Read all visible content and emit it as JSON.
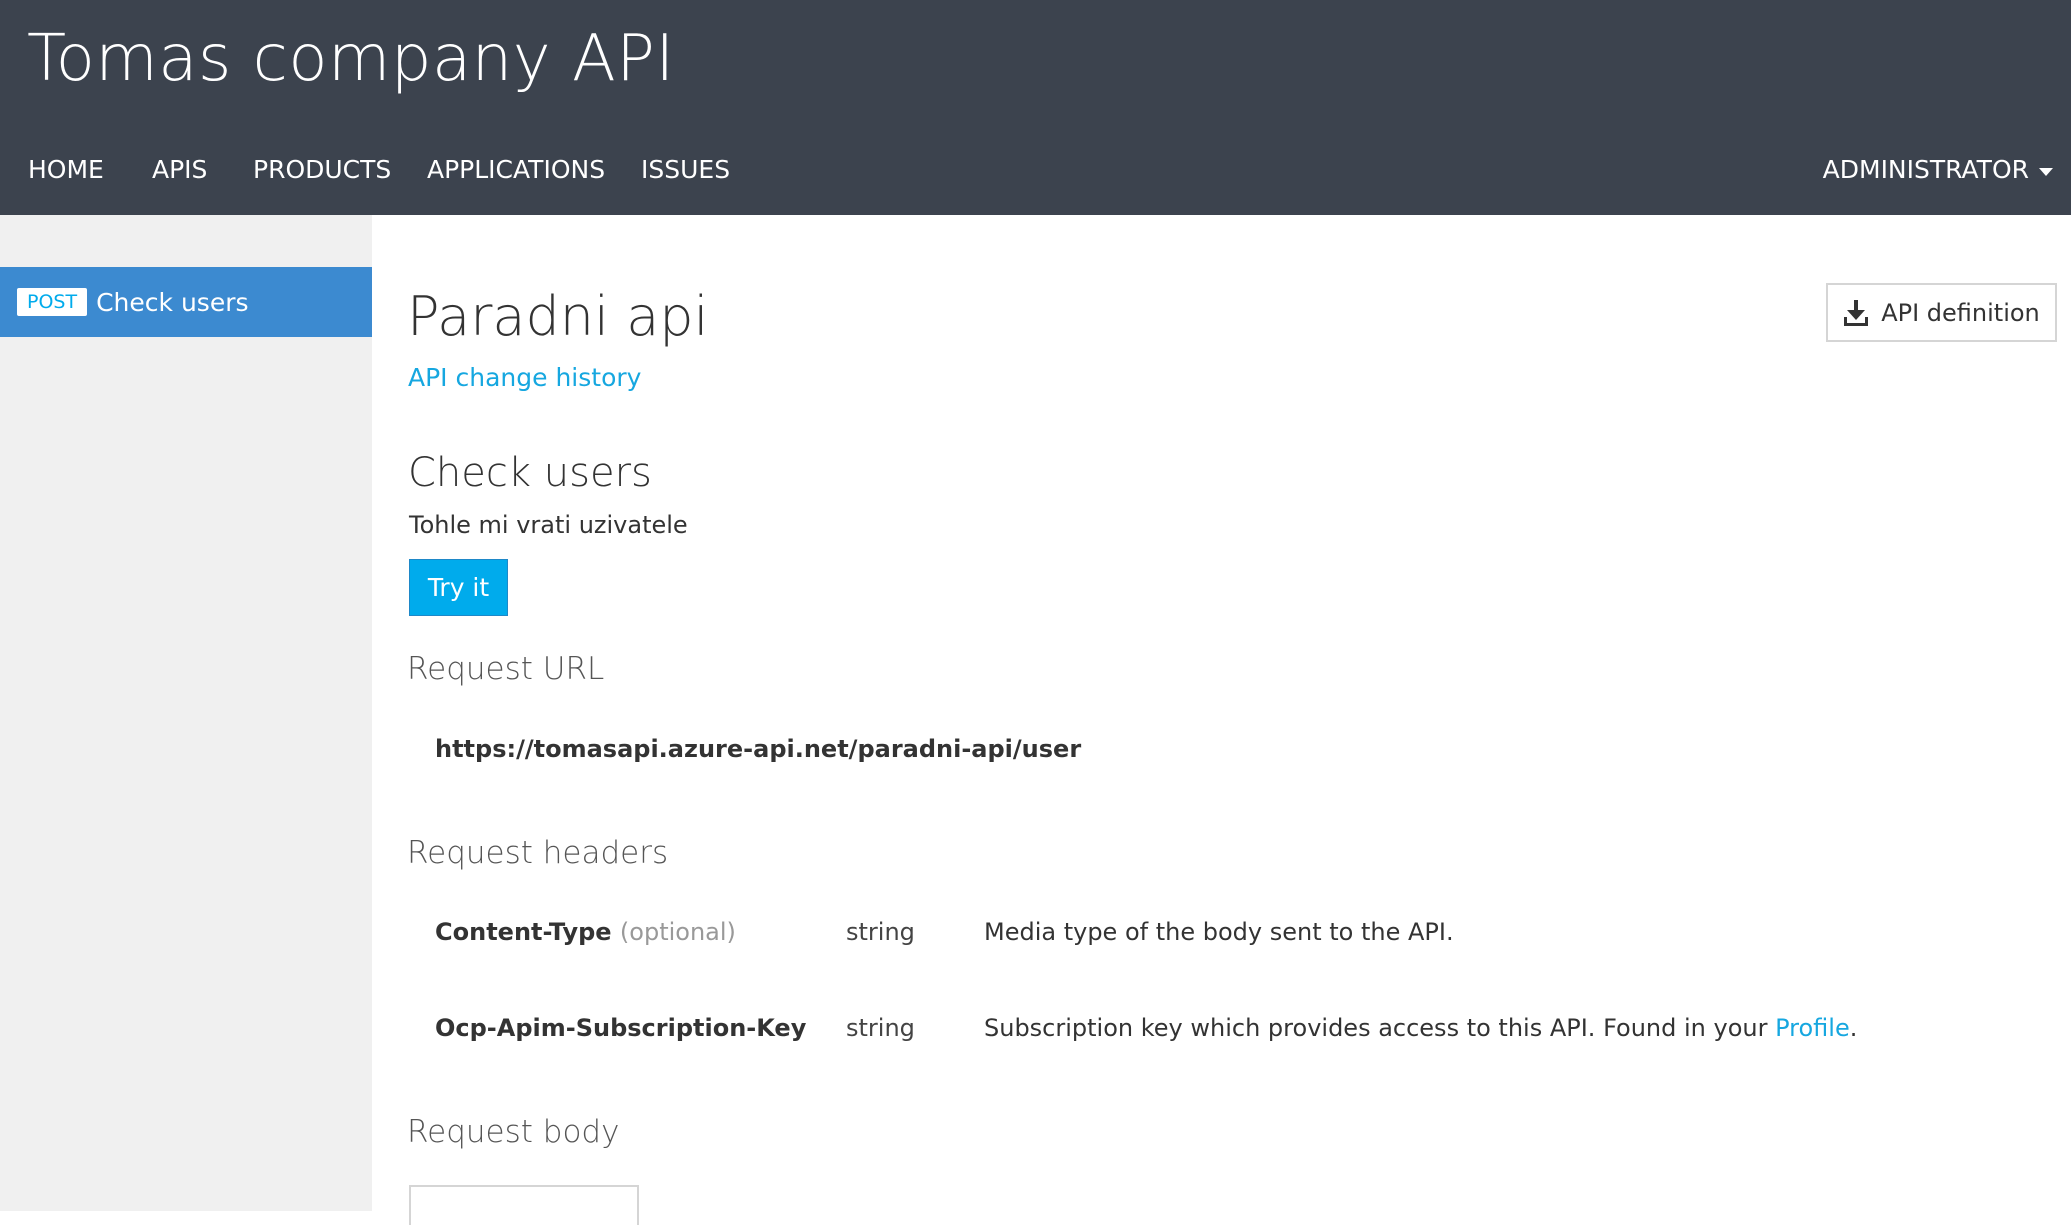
{
  "header": {
    "site_title": "Tomas company API",
    "nav": [
      "HOME",
      "APIS",
      "PRODUCTS",
      "APPLICATIONS",
      "ISSUES"
    ],
    "user_menu": "ADMINISTRATOR"
  },
  "sidebar": {
    "operations": [
      {
        "method": "POST",
        "label": "Check users"
      }
    ]
  },
  "main": {
    "api_title": "Paradni api",
    "history_link": "API change history",
    "definition_button": "API definition",
    "operation_title": "Check users",
    "operation_description": "Tohle mi vrati uzivatele",
    "try_button": "Try it",
    "request_url_heading": "Request URL",
    "request_url": "https://tomasapi.azure-api.net/paradni-api/user",
    "request_headers_heading": "Request headers",
    "headers": [
      {
        "name": "Content-Type",
        "optional": "(optional)",
        "type": "string",
        "description": "Media type of the body sent to the API."
      },
      {
        "name": "Ocp-Apim-Subscription-Key",
        "optional": "",
        "type": "string",
        "description": "Subscription key which provides access to this API. Found in your",
        "link": "Profile",
        "suffix": "."
      }
    ],
    "request_body_heading": "Request body"
  },
  "colors": {
    "header_bg": "#3c434e",
    "sidebar_bg": "#f0f0f0",
    "active_item_bg": "#3c8ad0",
    "accent": "#00abec",
    "link": "#16a7e0"
  },
  "icons": {
    "download": "download-icon",
    "caret": "caret-down-icon"
  }
}
